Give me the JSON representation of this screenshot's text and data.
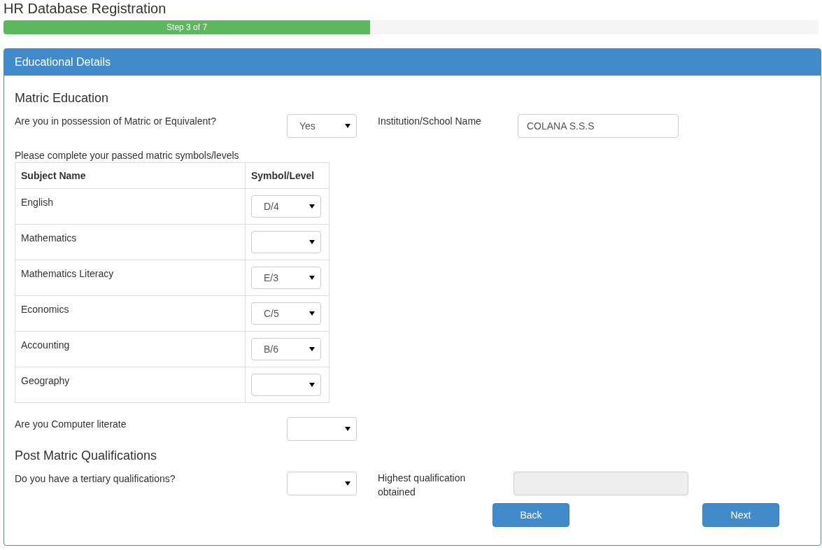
{
  "page_title": "HR Database Registration",
  "progress": {
    "label": "Step 3 of 7",
    "level": 0.45
  },
  "panel": {
    "title": "Educational Details"
  },
  "matric": {
    "heading": "Matric Education",
    "possession": {
      "label": "Are you in possession of Matric or Equivalent?",
      "value": "Yes"
    },
    "institution": {
      "label": "Institution/School Name",
      "value": "COLANA S.S.S",
      "disabled": false
    },
    "table_caption": "Please complete your passed matric symbols/levels",
    "columns": [
      "Subject Name",
      "Symbol/Level"
    ],
    "rows": [
      {
        "subject": "English",
        "symbol": "D/4"
      },
      {
        "subject": "Mathematics",
        "symbol": ""
      },
      {
        "subject": "Mathematics Literacy",
        "symbol": "E/3"
      },
      {
        "subject": "Economics",
        "symbol": "C/5"
      },
      {
        "subject": "Accounting",
        "symbol": "B/6"
      },
      {
        "subject": "Geography",
        "symbol": ""
      }
    ],
    "computer": {
      "label": "Are you Computer literate"
    }
  },
  "post_matric": {
    "heading": "Post Matric Qualifications",
    "tertiary": {
      "label": "Do you have a tertiary qualifications?"
    },
    "highest": {
      "label": "Highest qualification obtained",
      "disabled": true
    }
  },
  "buttons": [
    "Back",
    "Next"
  ]
}
